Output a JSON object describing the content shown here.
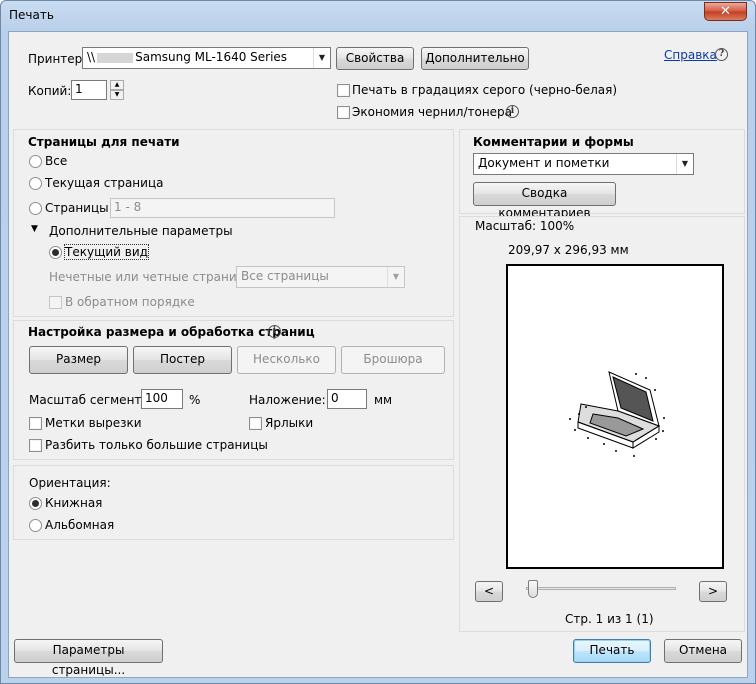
{
  "window": {
    "title": "Печать",
    "close_glyph": "✕"
  },
  "printer": {
    "label": "Принтер:",
    "value_prefix": "\\\\",
    "value": "Samsung ML-1640 Series",
    "properties_button": "Свойства",
    "advanced_button": "Дополнительно",
    "help_link": "Справка"
  },
  "copies": {
    "label": "Копий:",
    "value": "1"
  },
  "options": {
    "grayscale": "Печать в градациях серого (черно-белая)",
    "save_ink": "Экономия чернил/тонера"
  },
  "pages": {
    "title": "Страницы для печати",
    "all": "Все",
    "current": "Текущая страница",
    "pages": "Страницы",
    "pages_value": "1 - 8",
    "more_options": "Дополнительные параметры",
    "current_view": "Текущий вид",
    "odd_even_label": "Нечетные или четные страницы:",
    "odd_even_value": "Все страницы",
    "reverse": "В обратном порядке"
  },
  "sizing": {
    "title": "Настройка размера и обработка страниц",
    "size_button": "Размер",
    "poster_button": "Постер",
    "multiple_button": "Несколько",
    "booklet_button": "Брошюра",
    "tile_scale_label": "Масштаб сегмента:",
    "tile_scale_value": "100",
    "tile_scale_unit": "%",
    "overlap_label": "Наложение:",
    "overlap_value": "0",
    "overlap_unit": "мм",
    "cut_marks": "Метки вырезки",
    "labels": "Ярлыки",
    "tile_large": "Разбить только большие страницы"
  },
  "orientation": {
    "title": "Ориентация:",
    "portrait": "Книжная",
    "landscape": "Альбомная"
  },
  "comments": {
    "title": "Комментарии и формы",
    "value": "Документ и пометки",
    "summarize_button": "Сводка комментариев"
  },
  "preview": {
    "scale": "Масштаб: 100%",
    "dimensions": "209,97 x 296,93 мм",
    "prev": "<",
    "next": ">",
    "page_info": "Стр. 1 из 1 (1)"
  },
  "footer": {
    "page_setup_button": "Параметры страницы...",
    "print_button": "Печать",
    "cancel_button": "Отмена"
  }
}
